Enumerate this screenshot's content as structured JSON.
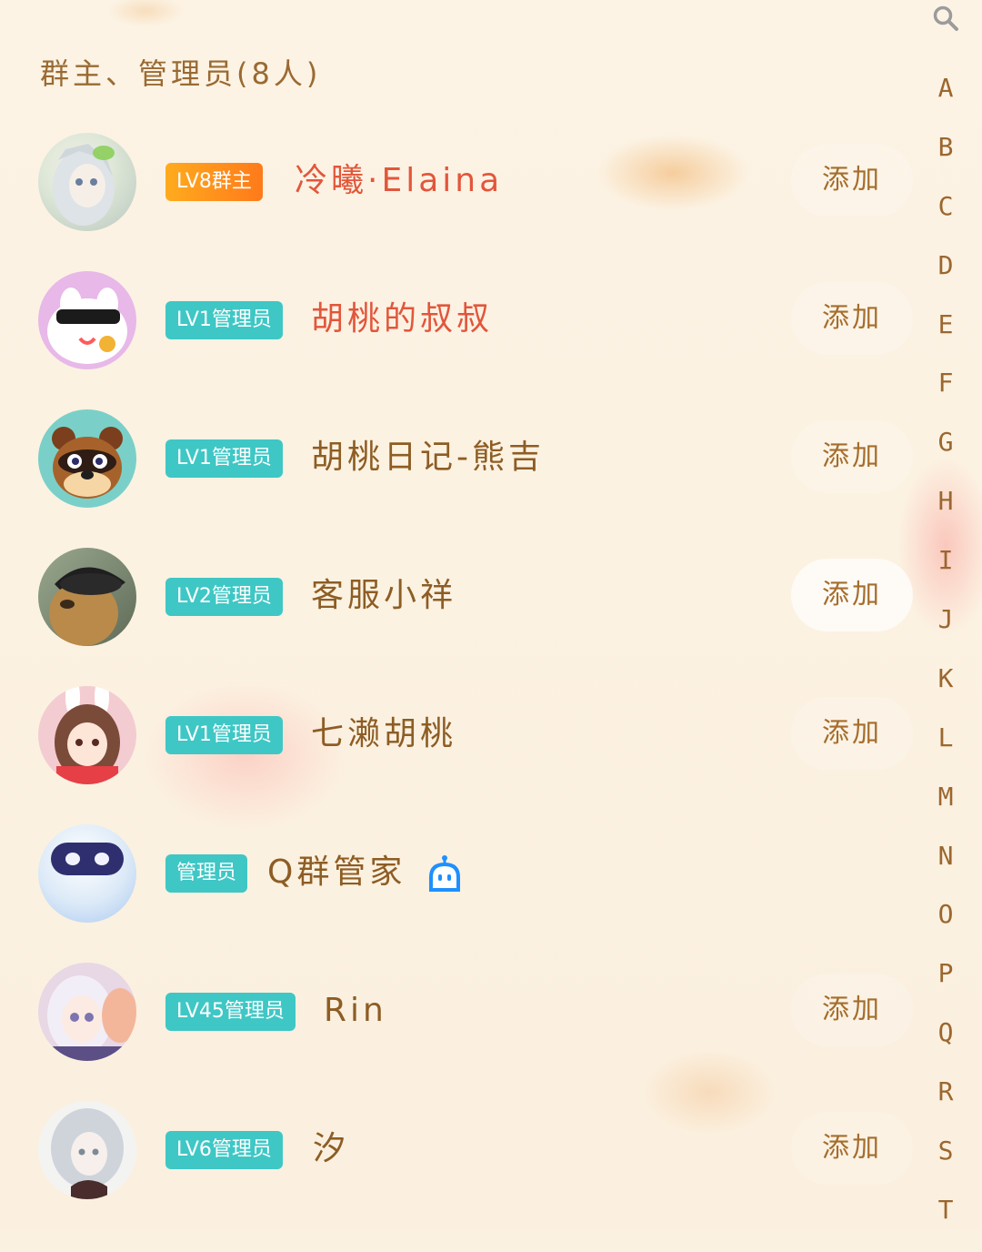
{
  "section_title": "群主、管理员(8人)",
  "search_icon": "search-icon",
  "members": [
    {
      "badge": "LV8群主",
      "badge_type": "owner",
      "name": "冷曦·Elaina",
      "name_color": "#e2563b",
      "add_label": "添加",
      "avatar_colors": [
        "#dfe8d8",
        "#b9c7bf",
        "#f2eee7"
      ]
    },
    {
      "badge": "LV1管理员",
      "badge_type": "admin",
      "name": "胡桃的叔叔",
      "name_color": "#e2563b",
      "add_label": "添加",
      "avatar_colors": [
        "#e7b8e8",
        "#ffffff",
        "#1b1b1b"
      ]
    },
    {
      "badge": "LV1管理员",
      "badge_type": "admin",
      "name": "胡桃日记-熊吉",
      "name_color": "#8d5d24",
      "add_label": "添加",
      "avatar_colors": [
        "#7ad0c9",
        "#8b4a22",
        "#f6d6a4"
      ]
    },
    {
      "badge": "LV2管理员",
      "badge_type": "admin",
      "name": "客服小祥",
      "name_color": "#8d5d24",
      "add_label": "添加",
      "avatar_colors": [
        "#7b8f72",
        "#b98a49",
        "#1f1f1f"
      ]
    },
    {
      "badge": "LV1管理员",
      "badge_type": "admin",
      "name": "七濑胡桃",
      "name_color": "#8d5d24",
      "add_label": "添加",
      "avatar_colors": [
        "#f3ccd1",
        "#7b4b39",
        "#e63f46"
      ]
    },
    {
      "badge": "管理员",
      "badge_type": "admin",
      "name": "Q群管家",
      "name_color": "#8d5d24",
      "add_label": "",
      "bot_icon": "robot-icon",
      "avatar_colors": [
        "#dbe9f7",
        "#a8c8f0",
        "#2f2f70"
      ]
    },
    {
      "badge": "LV45管理员",
      "badge_type": "admin",
      "name": "Rin",
      "name_color": "#8d5d24",
      "add_label": "添加",
      "avatar_colors": [
        "#e8d7e4",
        "#7d74b0",
        "#f4b69a"
      ]
    },
    {
      "badge": "LV6管理员",
      "badge_type": "admin",
      "name": "汐",
      "name_color": "#8d5d24",
      "add_label": "添加",
      "avatar_colors": [
        "#f3f3f2",
        "#cfd4db",
        "#7f8a95"
      ]
    }
  ],
  "index_letters": [
    "A",
    "B",
    "C",
    "D",
    "E",
    "F",
    "G",
    "H",
    "I",
    "J",
    "K",
    "L",
    "M",
    "N",
    "O",
    "P",
    "Q",
    "R",
    "S",
    "T"
  ]
}
